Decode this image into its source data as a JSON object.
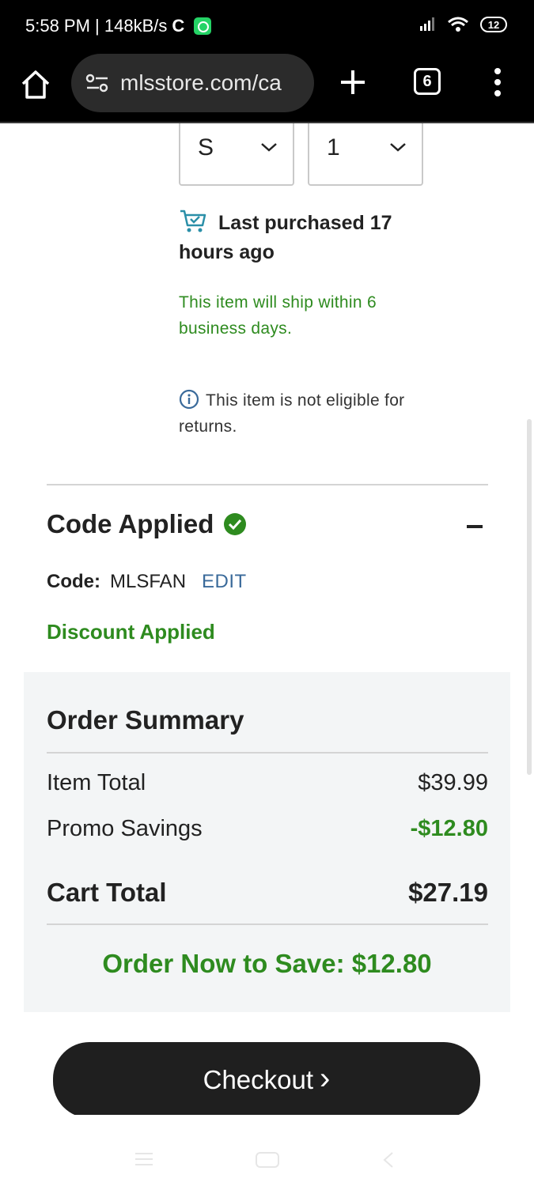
{
  "status_bar": {
    "time_speed": "5:58 PM | 148kB/s",
    "sync_glyph": "C",
    "battery": "12"
  },
  "browser": {
    "url": "mlsstore.com/ca",
    "tab_count": "6"
  },
  "item": {
    "size": "S",
    "quantity": "1",
    "last_purchased": "Last purchased 17 hours ago",
    "shipping_note": "This item will ship within 6 business days.",
    "returns_note": "This item is not eligible for returns."
  },
  "promo": {
    "title": "Code Applied",
    "code_label": "Code:",
    "code_value": "MLSFAN",
    "edit_label": "EDIT",
    "discount_label": "Discount Applied"
  },
  "summary": {
    "title": "Order Summary",
    "item_total_label": "Item Total",
    "item_total_value": "$39.99",
    "promo_label": "Promo Savings",
    "promo_value": "-$12.80",
    "cart_total_label": "Cart Total",
    "cart_total_value": "$27.19",
    "save_message": "Order Now to Save: $12.80"
  },
  "checkout": {
    "label": "Checkout",
    "chevron": "›"
  },
  "colors": {
    "accent_green": "#2e8b1f",
    "link_blue": "#3a6a9a",
    "button_dark": "#1f1f1f"
  }
}
